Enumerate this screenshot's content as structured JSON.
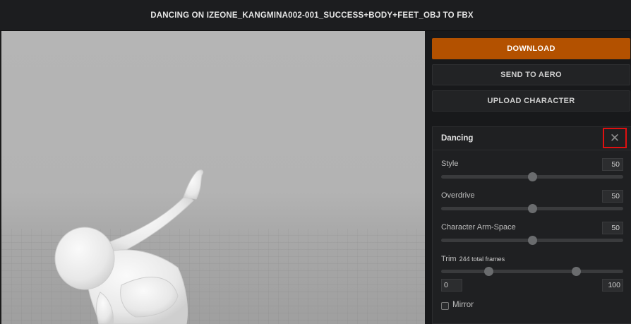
{
  "header": {
    "title": "DANCING ON IZEONE_KANGMINA002-001_SUCCESS+BODY+FEET_OBJ TO FBX"
  },
  "actions": {
    "download_label": "DOWNLOAD",
    "send_label": "SEND TO AERO",
    "upload_label": "UPLOAD CHARACTER"
  },
  "animation_panel": {
    "name": "Dancing",
    "close_icon": "close-icon",
    "style": {
      "label": "Style",
      "value": "50",
      "fraction": 0.5
    },
    "overdrive": {
      "label": "Overdrive",
      "value": "50",
      "fraction": 0.5
    },
    "arm_space": {
      "label": "Character Arm-Space",
      "value": "50",
      "fraction": 0.5
    },
    "trim": {
      "label": "Trim",
      "note": "244 total frames",
      "start": "0",
      "end": "100",
      "low_fraction": 0.26,
      "high_fraction": 0.74
    },
    "mirror": {
      "label": "Mirror",
      "checked": false
    }
  },
  "colors": {
    "accent": "#b35100",
    "highlight_border": "#e01010"
  }
}
